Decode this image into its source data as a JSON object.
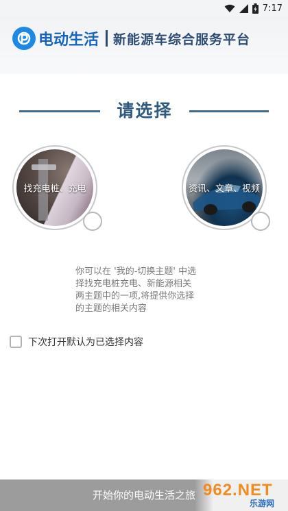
{
  "status_bar": {
    "time": "7:17",
    "icons": [
      "wifi-icon",
      "signal-icon",
      "battery-icon"
    ]
  },
  "header": {
    "brand_name": "电动生活",
    "slogan": "新能源车综合服务平台",
    "logo_icon": "p-logo-icon"
  },
  "prompt_title": "请选择",
  "options": [
    {
      "label": "找充电桩、充电"
    },
    {
      "label": "资讯、文章、视频"
    }
  ],
  "description_lines": [
    "你可以在 '我的-切换主题' 中选",
    "择找充电桩充电、新能源相关",
    "两主题中的一项,将提供你选择",
    "的主题的相关内容"
  ],
  "default_checkbox_label": "下次打开默认为已选择内容",
  "start_button_label": "开始你的电动生活之旅",
  "watermark": {
    "main": "962.NET",
    "sub": "乐游网"
  },
  "colors": {
    "brand_blue": "#1565c0",
    "title_blue": "#2f5a80",
    "start_bar": "#9c9c9c"
  }
}
